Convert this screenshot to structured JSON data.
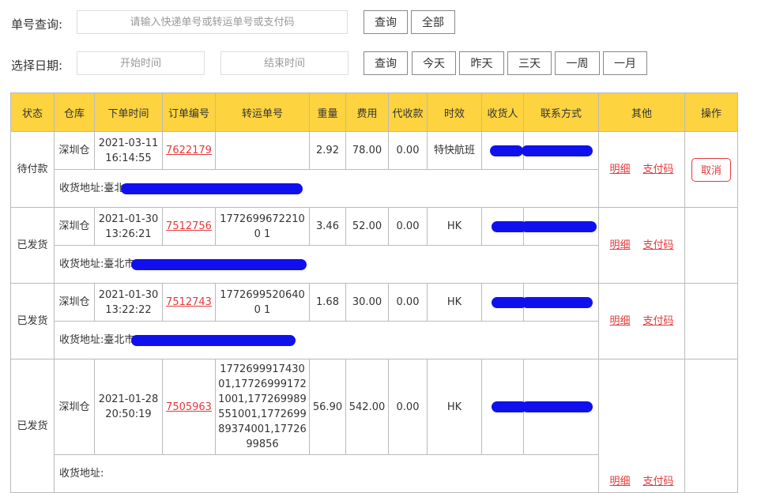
{
  "search": {
    "label": "单号查询:",
    "placeholder": "请输入快递单号或转运单号或支付码",
    "query_btn": "查询",
    "all_btn": "全部"
  },
  "date": {
    "label": "选择日期:",
    "start_placeholder": "开始时间",
    "end_placeholder": "结束时间",
    "query_btn": "查询",
    "today_btn": "今天",
    "yesterday_btn": "昨天",
    "three_days_btn": "三天",
    "week_btn": "一周",
    "month_btn": "一月"
  },
  "table": {
    "headers": [
      "状态",
      "仓库",
      "下单时间",
      "订单编号",
      "转运单号",
      "重量",
      "费用",
      "代收款",
      "时效",
      "收货人",
      "联系方式",
      "其他",
      "操作"
    ],
    "address_label": "收货地址:",
    "detail_link": "明细",
    "pay_link": "支付码",
    "cancel_btn": "取消",
    "rows": [
      {
        "status": "待付款",
        "warehouse": "深圳仓",
        "date": "2021-03-11",
        "time": "16:14:55",
        "order_no": "7622179",
        "transfer_no": "",
        "weight": "2.92",
        "fee": "78.00",
        "cod": "0.00",
        "aging": "特快航班",
        "address_prefix": "臺北"
      },
      {
        "status": "已发货",
        "warehouse": "深圳仓",
        "date": "2021-01-30",
        "time": "13:26:21",
        "order_no": "7512756",
        "transfer_no": "17726996722100 1",
        "weight": "3.46",
        "fee": "52.00",
        "cod": "0.00",
        "aging": "HK",
        "address_prefix": "臺北市"
      },
      {
        "status": "已发货",
        "warehouse": "深圳仓",
        "date": "2021-01-30",
        "time": "13:22:22",
        "order_no": "7512743",
        "transfer_no": "17726995206400 1",
        "weight": "1.68",
        "fee": "30.00",
        "cod": "0.00",
        "aging": "HK",
        "address_prefix": "臺北市"
      },
      {
        "status": "已发货",
        "warehouse": "深圳仓",
        "date": "2021-01-28",
        "time": "20:50:19",
        "order_no": "7505963",
        "transfer_no": "177269991743001,177269991721001,177269989551001,177269989374001,1772699856",
        "weight": "56.90",
        "fee": "542.00",
        "cod": "0.00",
        "aging": "HK",
        "address_prefix": ""
      }
    ]
  },
  "colors": {
    "header_bg": "#fdd33f",
    "link": "#e4393c",
    "redaction": "#1010ee"
  }
}
